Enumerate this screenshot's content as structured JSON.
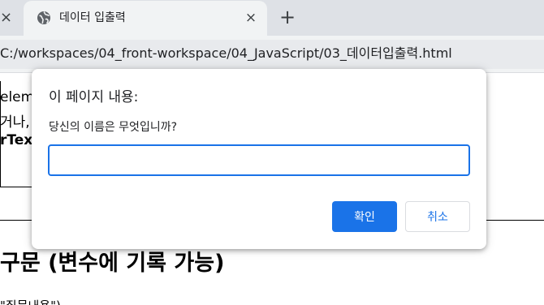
{
  "browser": {
    "prev_tab_close": "×",
    "tab": {
      "title": "데이터 입출력",
      "icon": "globe-icon",
      "close": "×"
    },
    "new_tab": "+",
    "address": "C:/workspaces/04_front-workspace/04_JavaScript/03_데이터입출력.html"
  },
  "page_behind": {
    "line1": "eleme",
    "line2": "거나,",
    "line3": "rText",
    "heading": "구문 (변수에 기록 가능)",
    "bottom": "\"질문내용\")"
  },
  "dialog": {
    "title": "이 페이지 내용:",
    "message": "당신의 이름은 무엇입니까?",
    "input_value": "",
    "ok_label": "확인",
    "cancel_label": "취소"
  },
  "colors": {
    "accent": "#1a73e8",
    "tabstrip": "#dee1e6",
    "toolbar": "#f1f3f4"
  }
}
